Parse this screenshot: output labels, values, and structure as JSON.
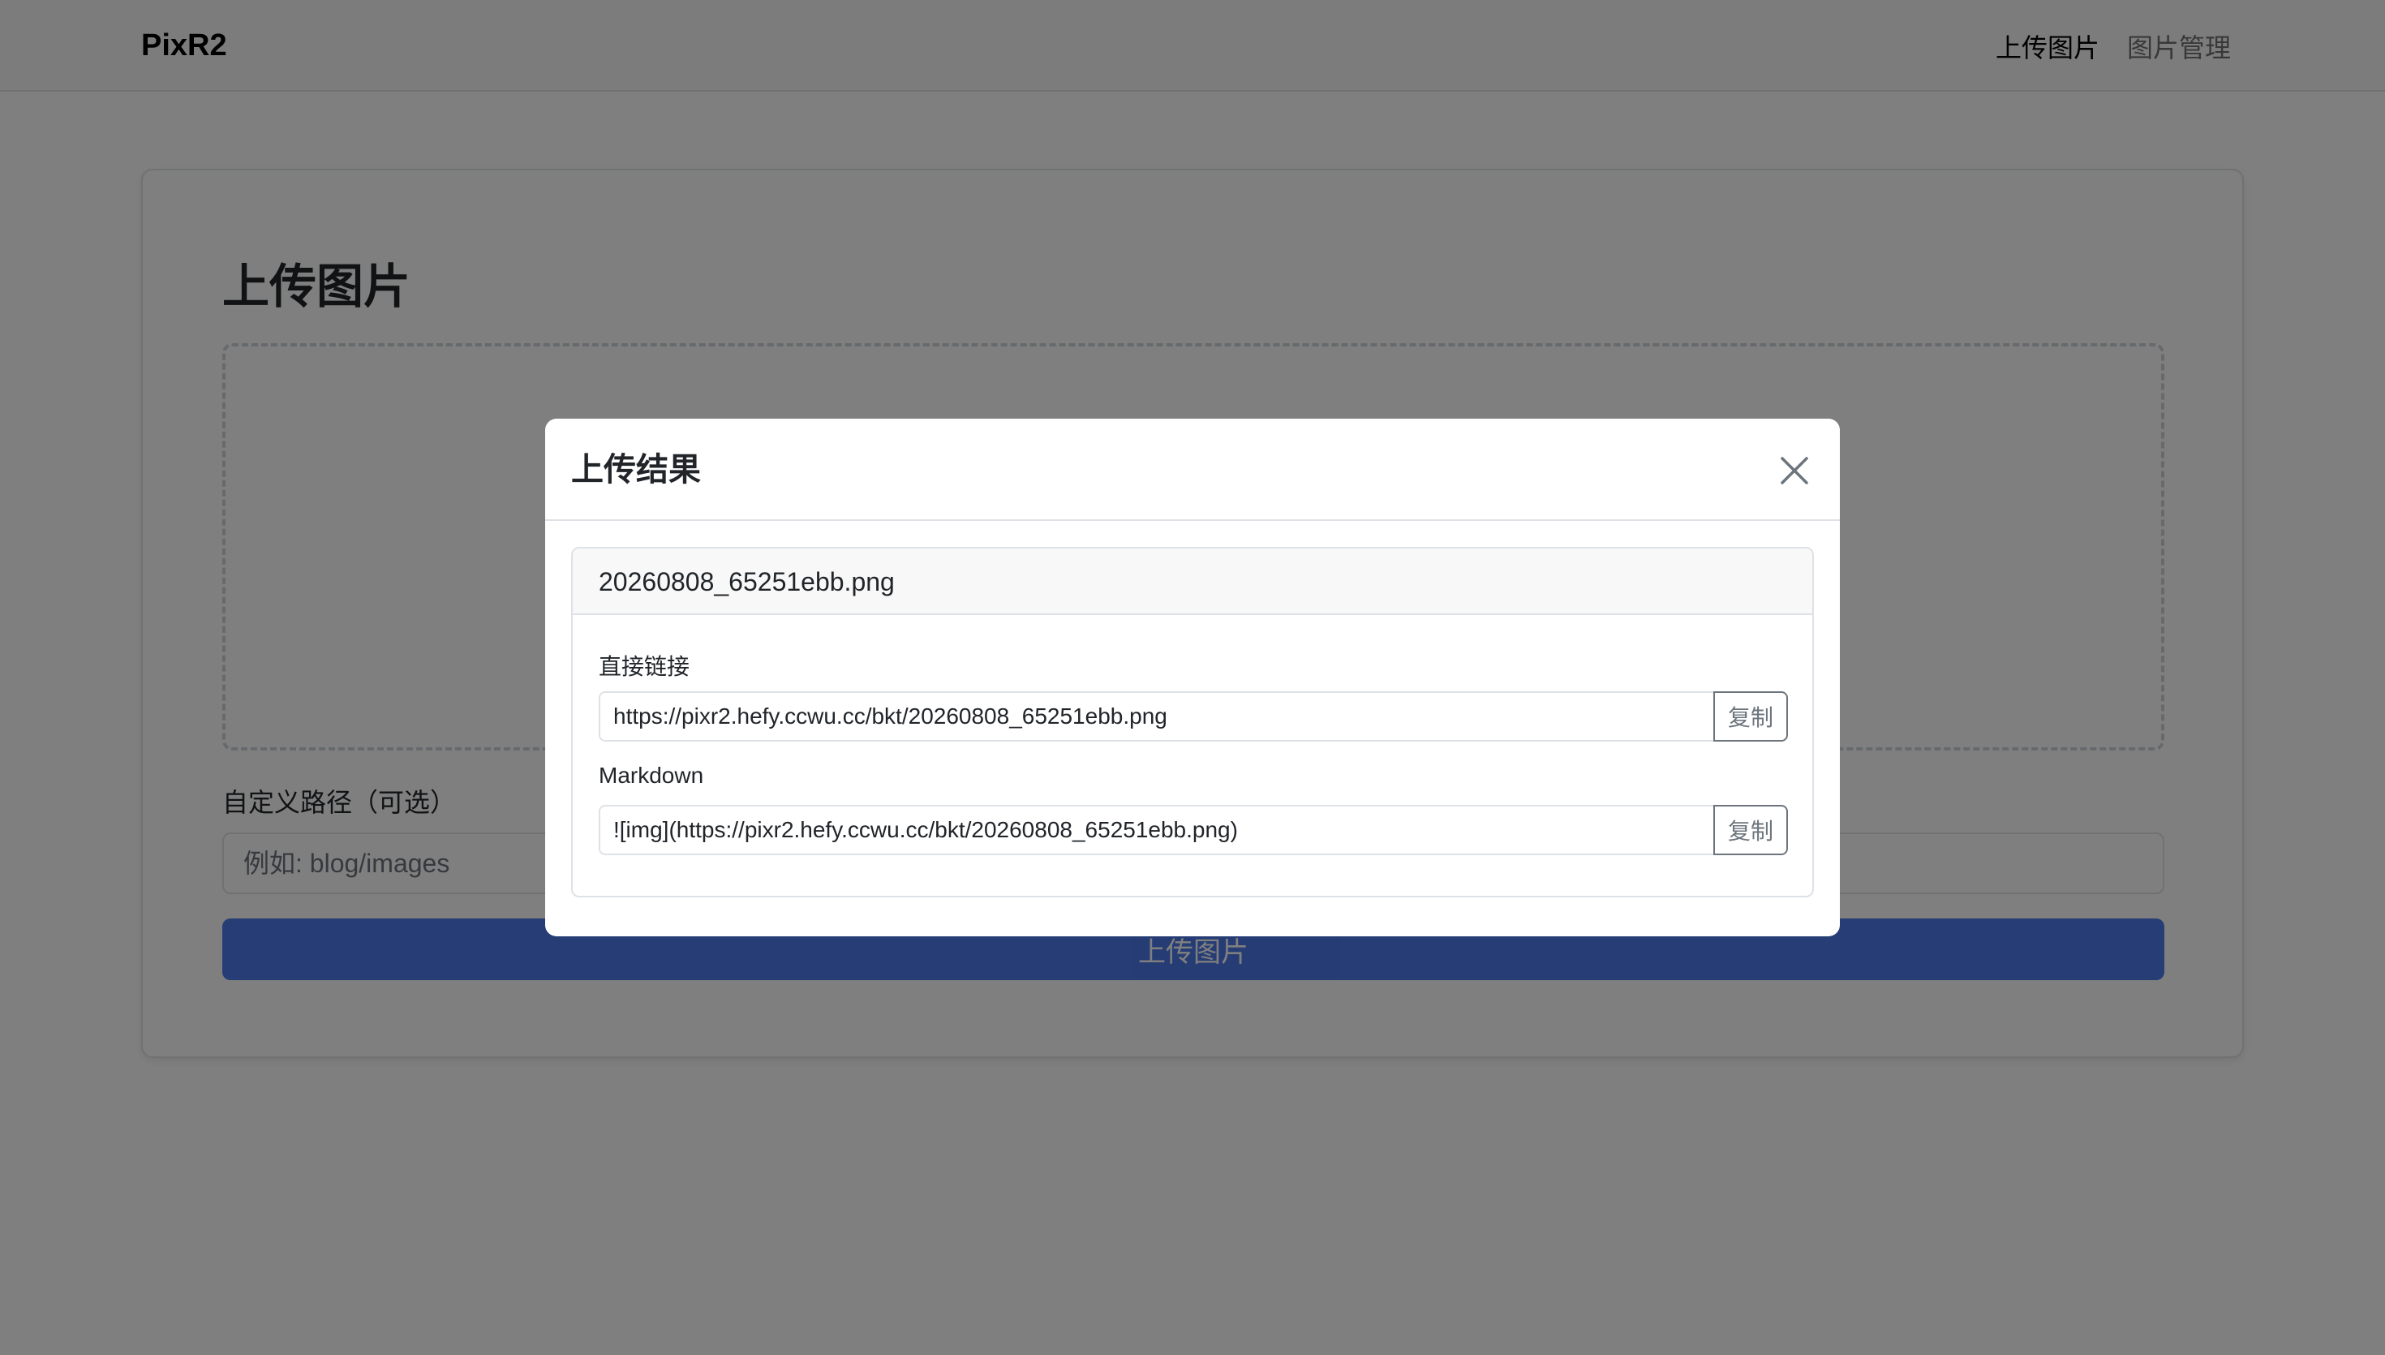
{
  "navbar": {
    "brand": "PixR2",
    "links": [
      {
        "label": "上传图片",
        "active": true
      },
      {
        "label": "图片管理",
        "active": false
      }
    ]
  },
  "main": {
    "title": "上传图片",
    "custom_path": {
      "label": "自定义路径（可选）",
      "placeholder": "例如: blog/images",
      "value": ""
    },
    "upload_button_label": "上传图片"
  },
  "modal": {
    "title": "上传结果",
    "close_icon": "close-icon",
    "file_name": "20260808_65251ebb.png",
    "direct_link": {
      "label": "直接链接",
      "value": "https://pixr2.hefy.ccwu.cc/bkt/20260808_65251ebb.png",
      "copy_label": "复制"
    },
    "markdown": {
      "label": "Markdown",
      "value": "![img](https://pixr2.hefy.ccwu.cc/bkt/20260808_65251ebb.png)",
      "copy_label": "复制"
    }
  },
  "colors": {
    "primary": "#3a6be8",
    "backdrop": "#000000",
    "border": "#dee2e6",
    "secondary": "#6c757d"
  }
}
